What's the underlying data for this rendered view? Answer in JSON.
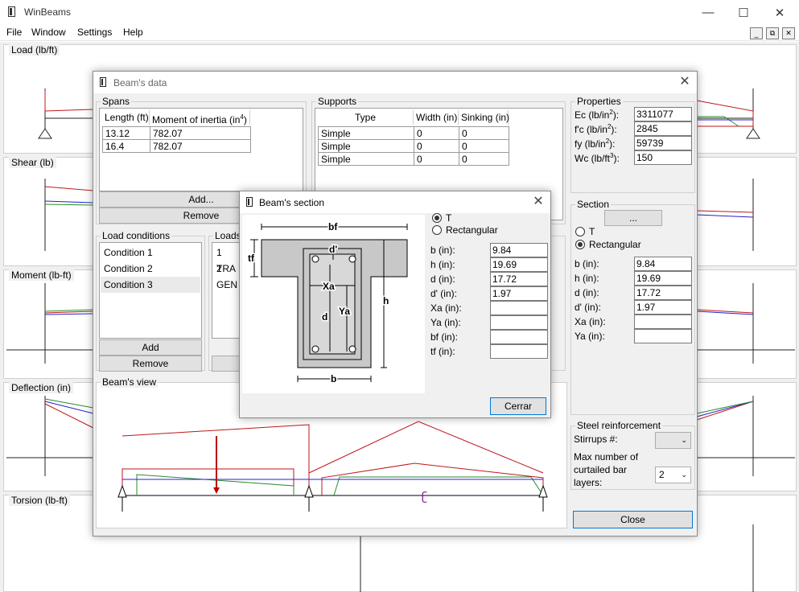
{
  "app": {
    "title": "WinBeams",
    "minimize": "—",
    "maximize": "☐",
    "close": "✕"
  },
  "menu": [
    "File",
    "Window",
    "Settings",
    "Help"
  ],
  "mdi": {
    "min": "_",
    "restore": "⧉",
    "close": "✕"
  },
  "panels": [
    "Load (lb/ft)",
    "Shear (lb)",
    "Moment (lb-ft)",
    "Deflection (in)",
    "Torsion (lb-ft)"
  ],
  "beams_data": {
    "title": "Beam's data",
    "spans": {
      "caption": "Spans",
      "headers": [
        "Length (ft)",
        "Moment of inertia (in",
        "4",
        ")"
      ],
      "rows": [
        [
          "13.12",
          "782.07"
        ],
        [
          "16.4",
          "782.07"
        ]
      ],
      "add": "Add...",
      "remove": "Remove"
    },
    "supports": {
      "caption": "Supports",
      "headers": [
        "Type",
        "Width (in)",
        "Sinking (in)"
      ],
      "rows": [
        [
          "Simple",
          "0",
          "0"
        ],
        [
          "Simple",
          "0",
          "0"
        ],
        [
          "Simple",
          "0",
          "0"
        ]
      ]
    },
    "properties": {
      "caption": "Properties",
      "items": [
        {
          "label": "Ec (lb/in",
          "sup": "2",
          "tail": "):",
          "value": "3311077"
        },
        {
          "label": "f'c (lb/in",
          "sup": "2",
          "tail": "):",
          "value": "2845"
        },
        {
          "label": "fy (lb/in",
          "sup": "2",
          "tail": "):",
          "value": "59739"
        },
        {
          "label": "Wc (lb/ft",
          "sup": "3",
          "tail": "):",
          "value": "150"
        }
      ]
    },
    "section": {
      "caption": "Section",
      "button": "...",
      "opt_t": "T",
      "opt_rect": "Rectangular",
      "fields": [
        {
          "label": "b (in):",
          "value": "9.84"
        },
        {
          "label": "h (in):",
          "value": "19.69"
        },
        {
          "label": "d (in):",
          "value": "17.72"
        },
        {
          "label": "d' (in):",
          "value": "1.97"
        },
        {
          "label": "Xa (in):",
          "value": ""
        },
        {
          "label": "Ya (in):",
          "value": ""
        }
      ]
    },
    "load_conditions": {
      "caption": "Load conditions",
      "items": [
        "Condition 1",
        "Condition 2",
        "Condition 3"
      ],
      "add": "Add",
      "remove": "Remove"
    },
    "loads": {
      "caption": "Loads",
      "items": [
        "1 TRA",
        "2 GEN"
      ]
    },
    "view": {
      "caption": "Beam's view"
    },
    "steel": {
      "caption": "Steel reinforcement",
      "stirrups": "Stirrups #:",
      "max_layers": "Max number of curtailed bar layers:",
      "layers_value": "2"
    },
    "close": "Close"
  },
  "section_dlg": {
    "title": "Beam's section",
    "opt_t": "T",
    "opt_rect": "Rectangular",
    "fields": [
      {
        "label": "b (in):",
        "value": "9.84"
      },
      {
        "label": "h (in):",
        "value": "19.69"
      },
      {
        "label": "d (in):",
        "value": "17.72"
      },
      {
        "label": "d' (in):",
        "value": "1.97"
      },
      {
        "label": "Xa (in):",
        "value": ""
      },
      {
        "label": "Ya (in):",
        "value": ""
      },
      {
        "label": "bf (in):",
        "value": ""
      },
      {
        "label": "tf (in):",
        "value": ""
      }
    ],
    "close": "Cerrar",
    "diagram": {
      "bf": "bf",
      "tf": "tf",
      "d_prime": "d'",
      "xa": "Xa",
      "ya": "Ya",
      "d": "d",
      "h": "h",
      "b": "b"
    }
  },
  "colors": {
    "red": "#c0161c",
    "green": "#2a8a2a",
    "blue": "#2020d0",
    "purple": "#8a1a9a"
  }
}
